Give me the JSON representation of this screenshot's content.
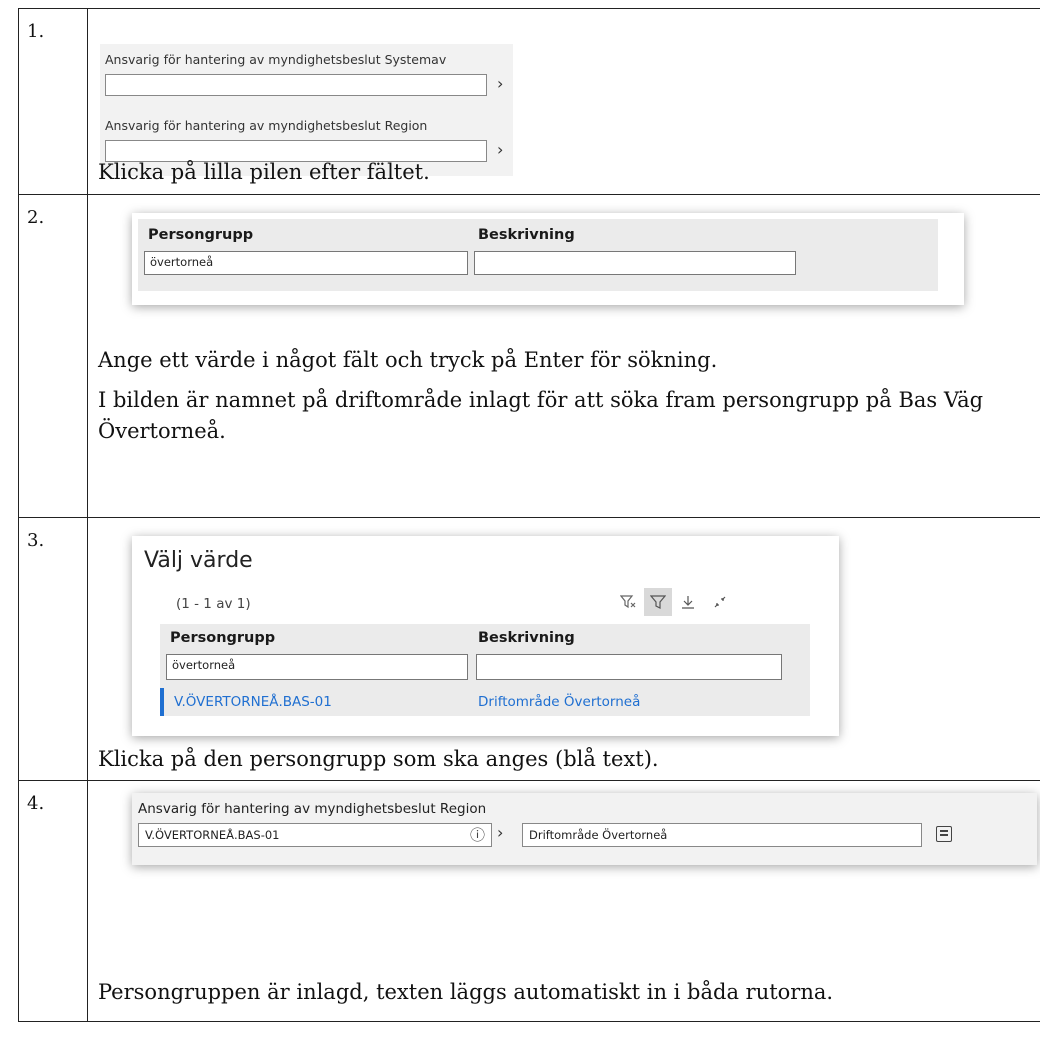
{
  "steps": [
    {
      "number": "1.",
      "screenshot": {
        "fields": [
          {
            "label": "Ansvarig för hantering av myndighetsbeslut Systemav",
            "value": "",
            "arrow": "›"
          },
          {
            "label": "Ansvarig för hantering av myndighetsbeslut Region",
            "value": "",
            "arrow": "›"
          }
        ]
      },
      "instructions": [
        "Klicka på lilla pilen efter fältet."
      ]
    },
    {
      "number": "2.",
      "screenshot": {
        "columns": [
          "Persongrupp",
          "Beskrivning"
        ],
        "filter_values": [
          "övertorneå",
          ""
        ]
      },
      "instructions": [
        "Ange ett värde i något fält och tryck på Enter för sökning.",
        "I bilden är namnet på driftområde inlagt för att söka fram persongrupp på Bas Väg Övertorneå."
      ]
    },
    {
      "number": "3.",
      "screenshot": {
        "title": "Välj värde",
        "count": "(1 - 1 av 1)",
        "tools": [
          "clear-filter-icon",
          "filter-icon",
          "download-icon",
          "collapse-icon"
        ],
        "columns": [
          "Persongrupp",
          "Beskrivning"
        ],
        "filter_values": [
          "övertorneå",
          ""
        ],
        "rows": [
          {
            "persongrupp": "V.ÖVERTORNEÅ.BAS-01",
            "beskrivning": "Driftområde Övertorneå"
          }
        ]
      },
      "instructions": [
        "Klicka på den persongrupp som ska anges (blå text)."
      ]
    },
    {
      "number": "4.",
      "screenshot": {
        "label": "Ansvarig för hantering av myndighetsbeslut Region",
        "value": "V.ÖVERTORNEÅ.BAS-01",
        "description": "Driftområde Övertorneå",
        "arrow": "›",
        "info_icon": "ⓘ"
      },
      "instructions": [
        "Persongruppen är inlagd, texten läggs automatiskt in i båda rutorna."
      ]
    }
  ],
  "colors": {
    "link": "#1f6fd1",
    "panel": "#ebebeb"
  }
}
